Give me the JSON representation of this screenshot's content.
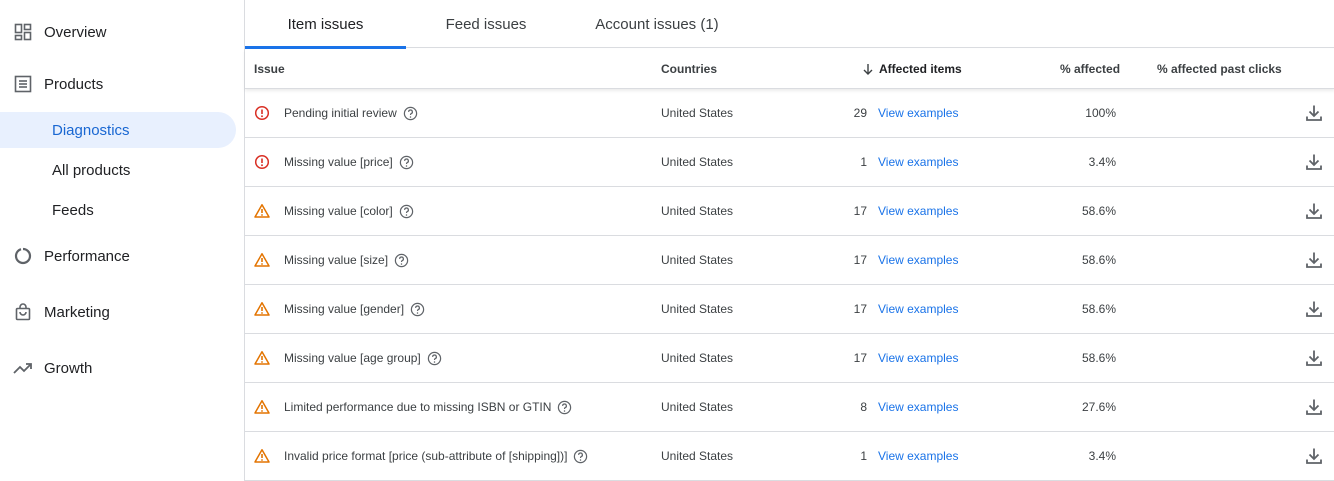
{
  "sidebar": {
    "items": [
      {
        "label": "Overview",
        "icon": "dashboard-icon"
      },
      {
        "label": "Products",
        "icon": "list-icon"
      },
      {
        "label": "Performance",
        "icon": "donut-chart-icon"
      },
      {
        "label": "Marketing",
        "icon": "shopping-bag-icon"
      },
      {
        "label": "Growth",
        "icon": "trending-up-icon"
      }
    ],
    "subitems": [
      {
        "label": "Diagnostics",
        "active": true
      },
      {
        "label": "All products",
        "active": false
      },
      {
        "label": "Feeds",
        "active": false
      }
    ]
  },
  "tabs": [
    {
      "label": "Item issues",
      "active": true
    },
    {
      "label": "Feed issues",
      "active": false
    },
    {
      "label": "Account issues (1)",
      "active": false
    }
  ],
  "table": {
    "headers": {
      "issue": "Issue",
      "countries": "Countries",
      "affected_items": "Affected items",
      "pct_affected": "% affected",
      "pct_past_clicks": "% affected past clicks"
    },
    "link_label": "View examples",
    "rows": [
      {
        "severity": "error",
        "issue": "Pending initial review",
        "country": "United States",
        "count": "29",
        "pct": "100%"
      },
      {
        "severity": "error",
        "issue": "Missing value [price]",
        "country": "United States",
        "count": "1",
        "pct": "3.4%"
      },
      {
        "severity": "warning",
        "issue": "Missing value [color]",
        "country": "United States",
        "count": "17",
        "pct": "58.6%"
      },
      {
        "severity": "warning",
        "issue": "Missing value [size]",
        "country": "United States",
        "count": "17",
        "pct": "58.6%"
      },
      {
        "severity": "warning",
        "issue": "Missing value [gender]",
        "country": "United States",
        "count": "17",
        "pct": "58.6%"
      },
      {
        "severity": "warning",
        "issue": "Missing value [age group]",
        "country": "United States",
        "count": "17",
        "pct": "58.6%"
      },
      {
        "severity": "warning",
        "issue": "Limited performance due to missing ISBN or GTIN",
        "country": "United States",
        "count": "8",
        "pct": "27.6%"
      },
      {
        "severity": "warning",
        "issue": "Invalid price format [price (sub-attribute of [shipping])]",
        "country": "United States",
        "count": "1",
        "pct": "3.4%"
      }
    ]
  },
  "colors": {
    "accent": "#1a73e8",
    "active_bg": "#e8f0fe",
    "error": "#d93025",
    "warning": "#e37400",
    "icon_gray": "#5f6368"
  }
}
